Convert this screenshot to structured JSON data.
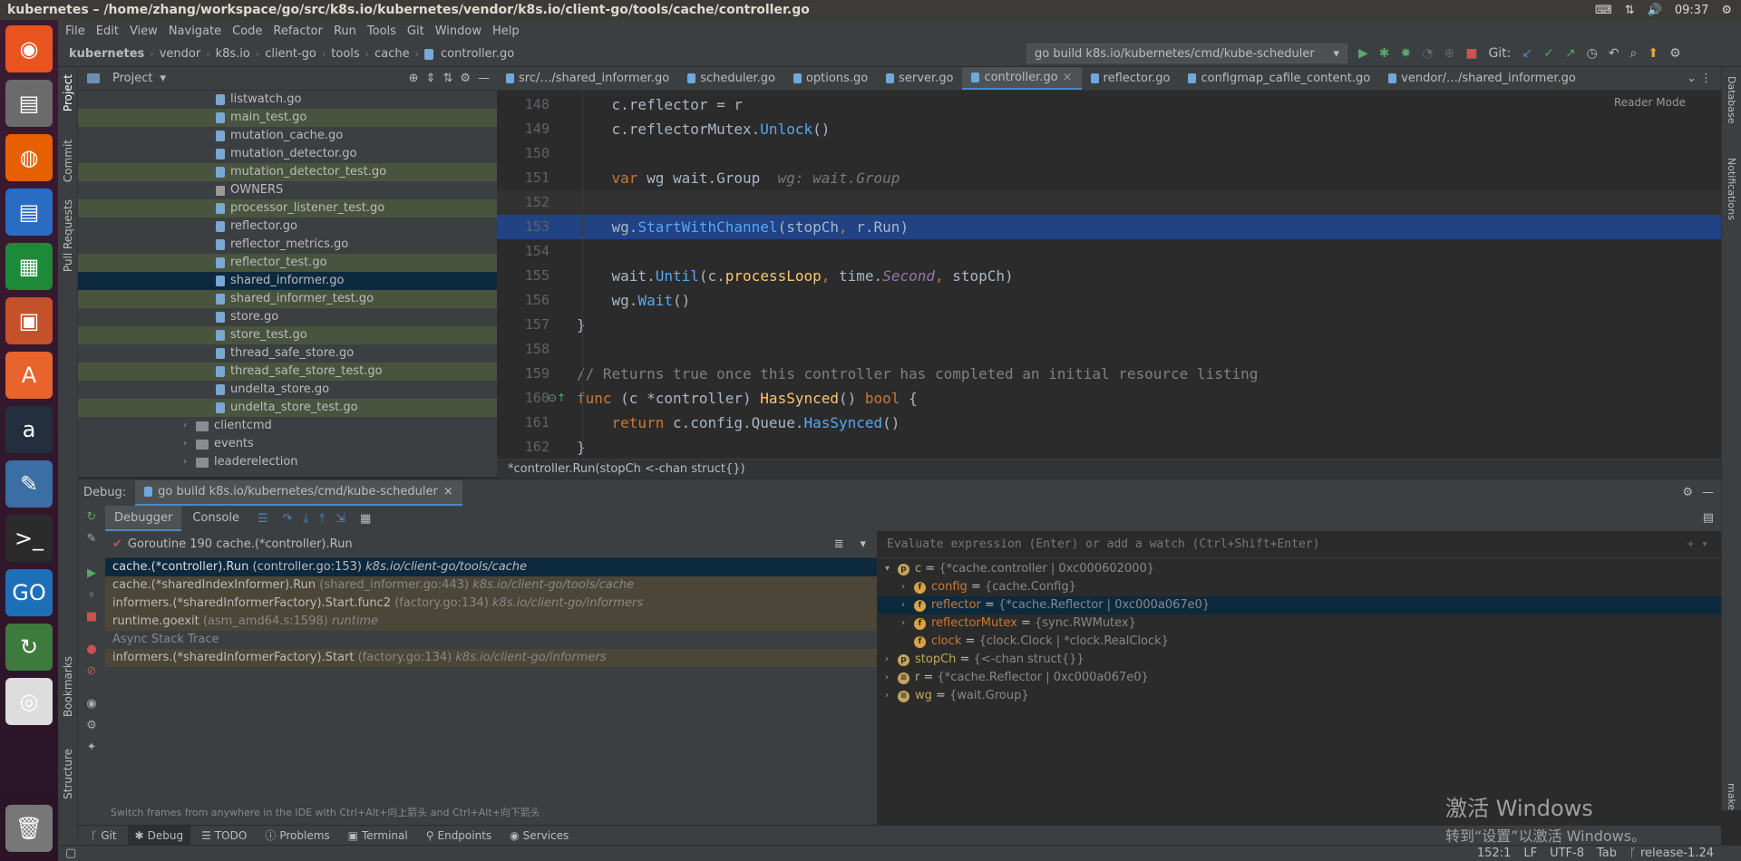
{
  "os": {
    "window_title": "kubernetes – /home/zhang/workspace/go/src/k8s.io/kubernetes/vendor/k8s.io/client-go/tools/cache/controller.go",
    "time": "09:37"
  },
  "launcher": [
    "ubuntu-icon",
    "files-icon",
    "firefox-icon",
    "writer-icon",
    "calc-icon",
    "impress-icon",
    "appstore-icon",
    "amazon-icon",
    "settings-icon",
    "terminal-icon",
    "goland-icon",
    "updater-icon",
    "dvd-icon",
    "trash-icon"
  ],
  "menu": [
    "File",
    "Edit",
    "View",
    "Navigate",
    "Code",
    "Refactor",
    "Run",
    "Tools",
    "Git",
    "Window",
    "Help"
  ],
  "breadcrumb": [
    "kubernetes",
    "vendor",
    "k8s.io",
    "client-go",
    "tools",
    "cache",
    "controller.go"
  ],
  "run_config": "go build k8s.io/kubernetes/cmd/kube-scheduler",
  "git_label": "Git:",
  "project_panel": {
    "title": "Project",
    "files": [
      {
        "name": "listwatch.go",
        "state": "normal",
        "kind": "file"
      },
      {
        "name": "main_test.go",
        "state": "mod",
        "kind": "file"
      },
      {
        "name": "mutation_cache.go",
        "state": "normal",
        "kind": "file"
      },
      {
        "name": "mutation_detector.go",
        "state": "normal",
        "kind": "file"
      },
      {
        "name": "mutation_detector_test.go",
        "state": "mod",
        "kind": "file"
      },
      {
        "name": "OWNERS",
        "state": "normal",
        "kind": "doc"
      },
      {
        "name": "processor_listener_test.go",
        "state": "mod",
        "kind": "file"
      },
      {
        "name": "reflector.go",
        "state": "normal",
        "kind": "file"
      },
      {
        "name": "reflector_metrics.go",
        "state": "normal",
        "kind": "file"
      },
      {
        "name": "reflector_test.go",
        "state": "mod",
        "kind": "file"
      },
      {
        "name": "shared_informer.go",
        "state": "sel",
        "kind": "file"
      },
      {
        "name": "shared_informer_test.go",
        "state": "mod",
        "kind": "file"
      },
      {
        "name": "store.go",
        "state": "normal",
        "kind": "file"
      },
      {
        "name": "store_test.go",
        "state": "mod",
        "kind": "file"
      },
      {
        "name": "thread_safe_store.go",
        "state": "normal",
        "kind": "file"
      },
      {
        "name": "thread_safe_store_test.go",
        "state": "mod",
        "kind": "file"
      },
      {
        "name": "undelta_store.go",
        "state": "normal",
        "kind": "file"
      },
      {
        "name": "undelta_store_test.go",
        "state": "mod",
        "kind": "file"
      }
    ],
    "folders": [
      "clientcmd",
      "events",
      "leaderelection"
    ]
  },
  "tabs": [
    {
      "label": "src/…/shared_informer.go",
      "active": false
    },
    {
      "label": "scheduler.go",
      "active": false
    },
    {
      "label": "options.go",
      "active": false
    },
    {
      "label": "server.go",
      "active": false
    },
    {
      "label": "controller.go",
      "active": true
    },
    {
      "label": "reflector.go",
      "active": false
    },
    {
      "label": "configmap_cafile_content.go",
      "active": false
    },
    {
      "label": "vendor/…/shared_informer.go",
      "active": false
    }
  ],
  "editor": {
    "reader_mode": "Reader Mode",
    "lines": [
      {
        "n": "148",
        "html": "    <span>c.reflector = r</span>"
      },
      {
        "n": "149",
        "html": "    c.reflectorMutex.<span class='mth'>Unlock</span>()"
      },
      {
        "n": "150",
        "html": ""
      },
      {
        "n": "151",
        "html": "    <span class='kw'>var</span> wg wait.Group  <span class='hint'>wg: wait.Group</span>"
      },
      {
        "n": "152",
        "html": "",
        "cls": "cur"
      },
      {
        "n": "153",
        "html": "    wg.<span class='mth'>StartWithChannel</span>(stopCh<span class='kw'>,</span> r.Run)",
        "cls": "hl"
      },
      {
        "n": "154",
        "html": ""
      },
      {
        "n": "155",
        "html": "    wait.<span class='mth'>Until</span>(c.<span class='fn'>processLoop</span><span class='kw'>,</span> time.<span class='it'>Second</span><span class='kw'>,</span> stopCh)"
      },
      {
        "n": "156",
        "html": "    wg.<span class='mth'>Wait</span>()"
      },
      {
        "n": "157",
        "html": "}"
      },
      {
        "n": "158",
        "html": ""
      },
      {
        "n": "159",
        "html": "<span class='cmt'>// Returns true once this controller has completed an initial resource listing</span>"
      },
      {
        "n": "160",
        "html": "<span class='kw'>func</span> (c *controller) <span class='fn'>HasSynced</span>() <span class='kw'>bool</span> {"
      },
      {
        "n": "161",
        "html": "    <span class='kw'>return</span> c.config.Queue.<span class='mth'>HasSynced</span>()"
      },
      {
        "n": "162",
        "html": "}"
      }
    ],
    "crumb": "*controller.Run(stopCh <-chan struct{})"
  },
  "debug": {
    "label": "Debug:",
    "session": "go build k8s.io/kubernetes/cmd/kube-scheduler",
    "tabs": [
      "Debugger",
      "Console"
    ],
    "goroutine": "Goroutine 190 cache.(*controller).Run",
    "frames": [
      {
        "fn": "cache.(*controller).Run",
        "loc": "(controller.go:153)",
        "pkg": "k8s.io/client-go/tools/cache",
        "cls": "sel"
      },
      {
        "fn": "cache.(*sharedIndexInformer).Run",
        "loc": "(shared_informer.go:443)",
        "pkg": "k8s.io/client-go/tools/cache",
        "cls": "lib"
      },
      {
        "fn": "informers.(*sharedInformerFactory).Start.func2",
        "loc": "(factory.go:134)",
        "pkg": "k8s.io/client-go/informers",
        "cls": "lib"
      },
      {
        "fn": "runtime.goexit",
        "loc": "(asm_amd64.s:1598)",
        "pkg": "runtime",
        "cls": "lib"
      }
    ],
    "async_label": "Async Stack Trace",
    "async_frames": [
      {
        "fn": "informers.(*sharedInformerFactory).Start",
        "loc": "(factory.go:134)",
        "pkg": "k8s.io/client-go/informers",
        "cls": "lib"
      }
    ],
    "hint": "Switch frames from anywhere in the IDE with Ctrl+Alt+向上箭头 and Ctrl+Alt+向下箭头",
    "eval_placeholder": "Evaluate expression (Enter) or add a watch (Ctrl+Shift+Enter)",
    "vars": [
      {
        "indent": 0,
        "arrow": "▾",
        "icon": "p",
        "color": "#c5a55a",
        "name": "c",
        "val": "{*cache.controller | 0xc000602000}",
        "sel": false
      },
      {
        "indent": 1,
        "arrow": "›",
        "icon": "f",
        "color": "#d9a343",
        "name": "config",
        "val": "{cache.Config}",
        "sel": false
      },
      {
        "indent": 1,
        "arrow": "›",
        "icon": "f",
        "color": "#d9a343",
        "name": "reflector",
        "val": "{*cache.Reflector | 0xc000a067e0}",
        "sel": true
      },
      {
        "indent": 1,
        "arrow": "›",
        "icon": "f",
        "color": "#d9a343",
        "name": "reflectorMutex",
        "val": "{sync.RWMutex}",
        "sel": false
      },
      {
        "indent": 1,
        "arrow": "",
        "icon": "f",
        "color": "#d9a343",
        "name": "clock",
        "val": "{clock.Clock | *clock.RealClock}",
        "sel": false
      },
      {
        "indent": 0,
        "arrow": "›",
        "icon": "p",
        "color": "#c5a55a",
        "name": "stopCh",
        "val": "{<-chan struct{}}",
        "sel": false
      },
      {
        "indent": 0,
        "arrow": "›",
        "icon": "≡",
        "color": "#c5a55a",
        "name": "r",
        "val": "{*cache.Reflector | 0xc000a067e0}",
        "sel": false
      },
      {
        "indent": 0,
        "arrow": "›",
        "icon": "≡",
        "color": "#c5a55a",
        "name": "wg",
        "val": "{wait.Group}",
        "sel": false
      }
    ]
  },
  "left_strip": [
    "Project",
    "Commit",
    "Pull Requests",
    "Bookmarks",
    "Structure"
  ],
  "right_strip": [
    "Database",
    "Notifications",
    "make"
  ],
  "bottom_tools": [
    {
      "label": "Git",
      "icon": "ᚴ"
    },
    {
      "label": "Debug",
      "icon": "✱"
    },
    {
      "label": "TODO",
      "icon": "☰"
    },
    {
      "label": "Problems",
      "icon": "ⓘ"
    },
    {
      "label": "Terminal",
      "icon": "▣"
    },
    {
      "label": "Endpoints",
      "icon": "⚲"
    },
    {
      "label": "Services",
      "icon": "◉"
    }
  ],
  "status": [
    "152:1",
    "LF",
    "UTF-8",
    "Tab",
    "release-1.24"
  ],
  "watermark": {
    "line1": "激活 Windows",
    "line2": "转到“设置”以激活 Windows。"
  }
}
